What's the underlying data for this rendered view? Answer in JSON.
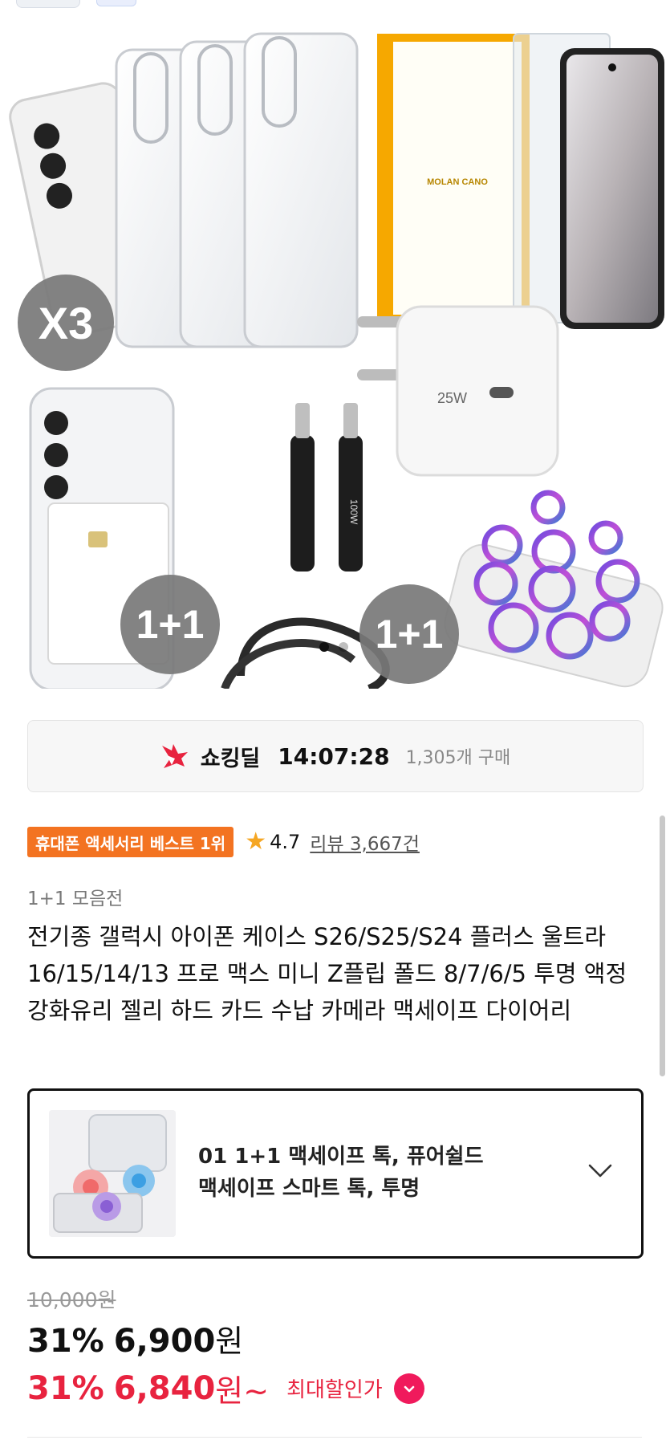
{
  "hero": {
    "badge_x3": "X3",
    "badge_1p1_a": "1+1",
    "badge_1p1_b": "1+1",
    "box_brand": "MOLAN CANO",
    "charger_label": "25W",
    "cable_label": "100W",
    "slide_count": 2,
    "active_slide": 1
  },
  "deal": {
    "icon": "shocking-deal-flame-icon",
    "name": "쇼킹딜",
    "timer": "14:07:28",
    "purchase_count": "1,305개 구매",
    "accent": "#e8233f"
  },
  "product": {
    "best_badge": "휴대폰 액세서리 베스트 1위",
    "rating": "4.7",
    "review_link": "리뷰 3,667건",
    "category": "1+1 모음전",
    "title": "전기종 갤럭시 아이폰 케이스 S26/S25/S24 플러스 울트라 16/15/14/13 프로 맥스 미니 Z플립 폴드 8/7/6/5 투명 액정 강화유리 젤리 하드 카드 수납 카메라 맥세이프 다이어리"
  },
  "option": {
    "line1": "01 1+1 맥세이프 톡, 퓨어쉴드",
    "line2": "맥세이프 스마트 톡, 투명",
    "icon": "chevron-down-icon"
  },
  "price": {
    "original": "10,000원",
    "discount_pct": "31%",
    "sale_amount": "6,900",
    "sale_won": "원",
    "max_pct": "31%",
    "max_amount": "6,840",
    "max_won": "원~",
    "max_label": "최대할인가",
    "brand_color": "#f01a5c"
  }
}
